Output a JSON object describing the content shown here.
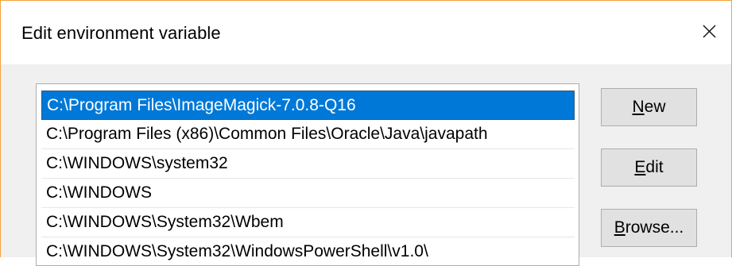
{
  "window": {
    "title": "Edit environment variable",
    "close_icon": "close-icon"
  },
  "path_list": {
    "items": [
      {
        "value": "C:\\Program Files\\ImageMagick-7.0.8-Q16",
        "selected": true
      },
      {
        "value": "C:\\Program Files (x86)\\Common Files\\Oracle\\Java\\javapath",
        "selected": false
      },
      {
        "value": "C:\\WINDOWS\\system32",
        "selected": false
      },
      {
        "value": "C:\\WINDOWS",
        "selected": false
      },
      {
        "value": "C:\\WINDOWS\\System32\\Wbem",
        "selected": false
      },
      {
        "value": "C:\\WINDOWS\\System32\\WindowsPowerShell\\v1.0\\",
        "selected": false
      }
    ]
  },
  "buttons": {
    "new": {
      "accel": "N",
      "rest": "ew"
    },
    "edit": {
      "accel": "E",
      "rest": "dit"
    },
    "browse": {
      "accel": "B",
      "rest": "rowse..."
    }
  },
  "colors": {
    "selection": "#0078d7",
    "window_border": "#f2a33a"
  }
}
